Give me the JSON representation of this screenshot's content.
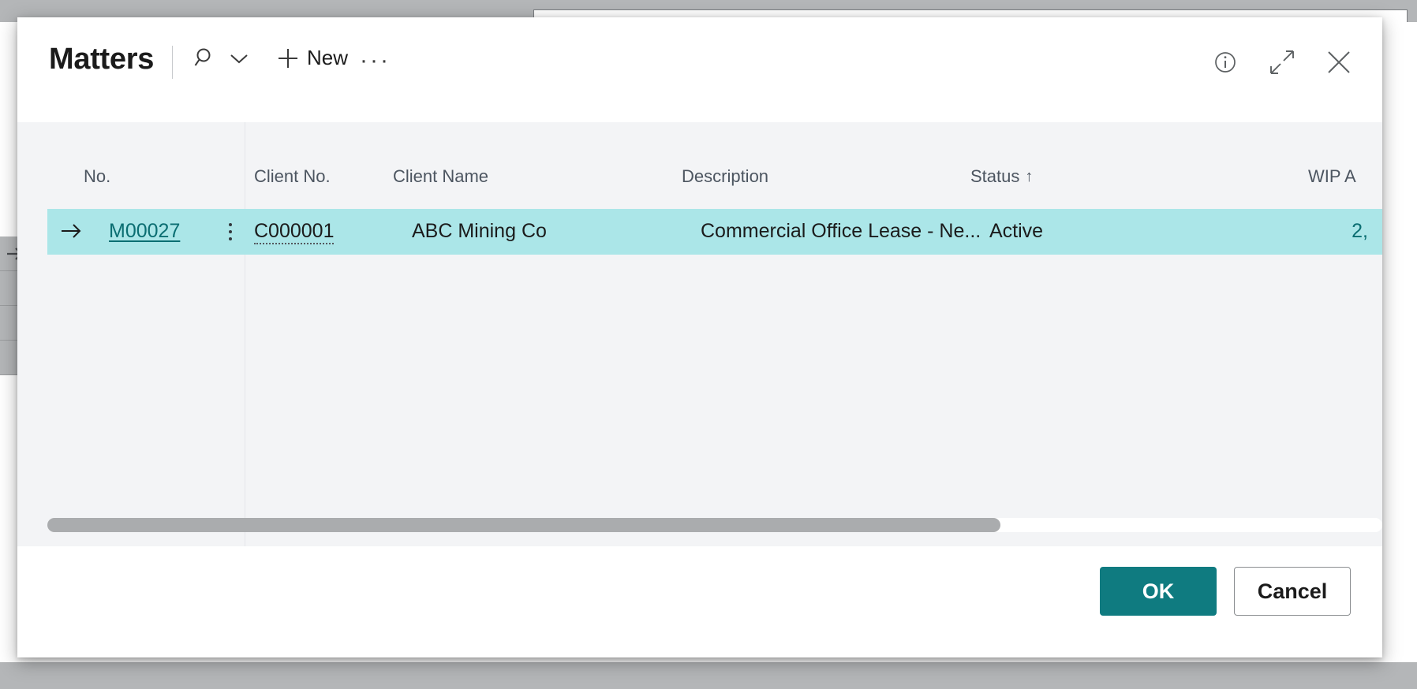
{
  "dialog": {
    "title": "Matters",
    "toolbar": {
      "search_icon": "search-icon",
      "search_chevron_icon": "chevron-down-icon",
      "new_icon": "plus-icon",
      "new_label": "New",
      "more_label": "···"
    },
    "window_controls": {
      "info_icon": "info-circle-icon",
      "expand_icon": "expand-diagonal-icon",
      "close_icon": "close-icon"
    }
  },
  "grid": {
    "columns": [
      {
        "label": "No.",
        "sorted": false
      },
      {
        "label": "Client No.",
        "sorted": false
      },
      {
        "label": "Client Name",
        "sorted": false
      },
      {
        "label": "Description",
        "sorted": false
      },
      {
        "label": "Status",
        "sorted": true,
        "sort_indicator": "↑"
      },
      {
        "label": "WIP A",
        "sorted": false
      }
    ],
    "rows": [
      {
        "selected": true,
        "row_indicator": "→",
        "no": "M00027",
        "client_no": "C000001",
        "client_name": "ABC Mining Co",
        "description": "Commercial Office Lease - Ne...",
        "status": "Active",
        "wip_amount": "2,"
      }
    ],
    "scrollbar": {
      "orientation": "horizontal",
      "thumb_fraction": 0.71
    }
  },
  "footer": {
    "ok_label": "OK",
    "cancel_label": "Cancel"
  },
  "colors": {
    "accent": "#0f7b80",
    "row_selected": "#abe6e8",
    "link": "#0b6e72",
    "grid_background": "#f3f4f6"
  }
}
